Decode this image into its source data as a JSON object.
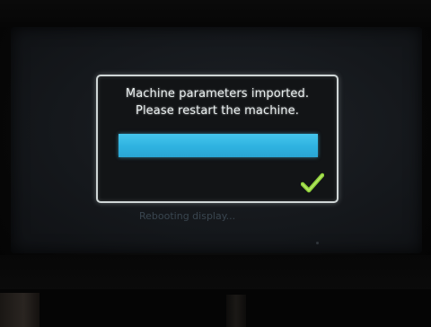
{
  "dialog": {
    "line1": "Machine parameters imported.",
    "line2": "Please restart the machine.",
    "progress_fraction": 1.0,
    "progress_color": "#2fb4e2",
    "status_icon": "checkmark-icon",
    "status_icon_color": "#8fd13a"
  },
  "footer": {
    "status_text": "Rebooting display..."
  }
}
